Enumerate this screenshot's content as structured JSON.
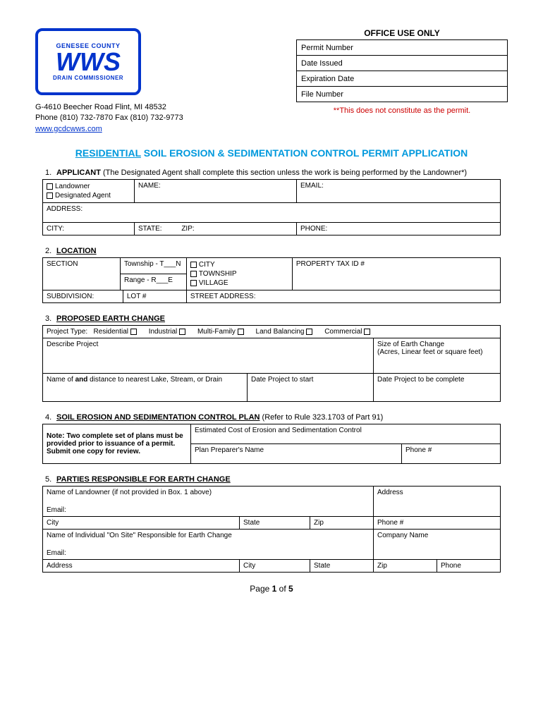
{
  "logo": {
    "top": "GENESEE COUNTY",
    "mid": "WWS",
    "bot": "DRAIN COMMISSIONER"
  },
  "org": {
    "addr": "G-4610 Beecher Road Flint, MI 48532",
    "phone": "Phone (810) 732-7870  Fax (810) 732-9773",
    "url": "www.gcdcwws.com"
  },
  "office": {
    "title": "OFFICE USE ONLY",
    "rows": {
      "permit": "Permit Number",
      "date": "Date Issued",
      "exp": "Expiration Date",
      "file": "File Number"
    },
    "disclaimer": "**This does not constitute as the permit."
  },
  "title": {
    "res": "RESIDENTIAL",
    "rest": " SOIL EROSION & SEDIMENTATION CONTROL PERMIT APPLICATION"
  },
  "s1": {
    "num": "1.",
    "label": "APPLICANT",
    "note": " (The Designated Agent shall complete this section unless the work is being performed by the Landowner*)",
    "landowner": "Landowner",
    "agent": "Designated Agent",
    "name": "NAME:",
    "email": "EMAIL:",
    "address": "ADDRESS:",
    "city": "CITY:",
    "state": "STATE:",
    "zip": "ZIP:",
    "phone": "PHONE:"
  },
  "s2": {
    "num": "2.",
    "label": "LOCATION",
    "section": "SECTION",
    "township": "Township -    T___N",
    "range": "Range -       R___E",
    "city": "CITY",
    "town": "TOWNSHIP",
    "village": "VILLAGE",
    "tax": "PROPERTY TAX ID #",
    "sub": "SUBDIVISION:",
    "lot": "LOT #",
    "street": "STREET ADDRESS:"
  },
  "s3": {
    "num": "3.",
    "label": "PROPOSED EARTH CHANGE",
    "ptype": "Project Type:",
    "res": "Residential",
    "ind": "Industrial",
    "mf": "Multi-Family",
    "lb": "Land Balancing",
    "com": "Commercial",
    "desc": "Describe Project",
    "size": "Size of Earth Change\n(Acres, Linear feet or square feet)",
    "lake": "Name of and distance to nearest Lake, Stream, or Drain",
    "start": "Date Project to start",
    "end": "Date Project to be complete"
  },
  "s4": {
    "num": "4.",
    "label": "SOIL EROSION AND SEDIMENTATION CONTROL PLAN",
    "note": " (Refer to Rule 323.1703 of Part 91)",
    "leftnote": "Note: Two complete set of plans must be provided prior to issuance of a permit.  Submit one copy for review.",
    "est": "Estimated Cost of Erosion and Sedimentation Control",
    "prep": "Plan Preparer's Name",
    "phone": "Phone #"
  },
  "s5": {
    "num": "5.",
    "label": "PARTIES RESPONSIBLE FOR EARTH CHANGE",
    "owner": "Name of Landowner (if not provided in Box. 1 above)",
    "address": "Address",
    "email": "Email:",
    "city": "City",
    "state": "State",
    "zip": "Zip",
    "phone": "Phone #",
    "onsite": "Name of Individual \"On Site\" Responsible for Earth Change",
    "company": "Company Name",
    "addr2": "Address",
    "phone2": "Phone"
  },
  "pagenum": "Page 1 of 5"
}
